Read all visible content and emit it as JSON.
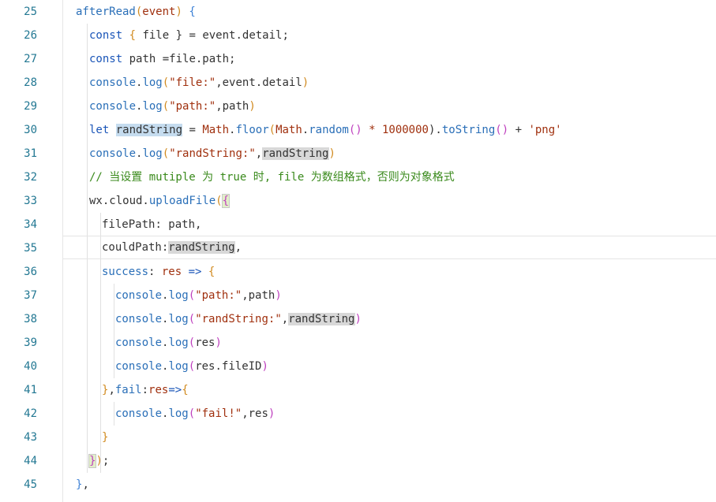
{
  "editor": {
    "line_numbers": [
      "25",
      "26",
      "27",
      "28",
      "29",
      "30",
      "31",
      "32",
      "33",
      "34",
      "35",
      "36",
      "37",
      "38",
      "39",
      "40",
      "41",
      "42",
      "43",
      "44",
      "45"
    ],
    "lines": {
      "l25": {
        "a": "afterRead",
        "b": "(",
        "c": "event",
        "d": ")",
        "e": " {"
      },
      "l26": {
        "a": "const",
        "b": " { ",
        "c": "file",
        "d": " } = event.detail;"
      },
      "l27": {
        "a": "const",
        "b": " path =file.path;"
      },
      "l28": {
        "a": "console",
        "b": ".",
        "c": "log",
        "d": "(",
        "e": "\"file:\"",
        "f": ",event.detail",
        "g": ")"
      },
      "l29": {
        "a": "console",
        "b": ".",
        "c": "log",
        "d": "(",
        "e": "\"path:\"",
        "f": ",path",
        "g": ")"
      },
      "l30": {
        "a": "let",
        "b": " ",
        "c": "randString",
        "d": " = ",
        "e": "Math",
        "f": ".",
        "g": "floor",
        "h": "(",
        "i": "Math",
        "j": ".",
        "k": "random",
        "l": "()",
        "m": " * ",
        "n": "1000000",
        "o": ").",
        "p": "toString",
        "q": "()",
        "r": " + ",
        "s": "'png'"
      },
      "l31": {
        "a": "console",
        "b": ".",
        "c": "log",
        "d": "(",
        "e": "\"randString:\"",
        "f": ",",
        "g": "randString",
        "h": ")"
      },
      "l32": {
        "a": "// 当设置 mutiple 为 true 时, file 为数组格式，否则为对象格式"
      },
      "l33": {
        "a": "wx.cloud.",
        "b": "uploadFile",
        "c": "(",
        "d": "{"
      },
      "l34": {
        "a": "filePath",
        "b": ": path,"
      },
      "l35": {
        "a": "couldPath",
        "b": ":",
        "c": "randString",
        "d": ","
      },
      "l36": {
        "a": "success",
        "b": ": ",
        "c": "res",
        "d": " => ",
        "e": "{"
      },
      "l37": {
        "a": "console",
        "b": ".",
        "c": "log",
        "d": "(",
        "e": "\"path:\"",
        "f": ",path",
        "g": ")"
      },
      "l38": {
        "a": "console",
        "b": ".",
        "c": "log",
        "d": "(",
        "e": "\"randString:\"",
        "f": ",",
        "g": "randString",
        "h": ")"
      },
      "l39": {
        "a": "console",
        "b": ".",
        "c": "log",
        "d": "(",
        "e": "res",
        "f": ")"
      },
      "l40": {
        "a": "console",
        "b": ".",
        "c": "log",
        "d": "(",
        "e": "res.fileID",
        "f": ")"
      },
      "l41": {
        "a": "}",
        "b": ",",
        "c": "fail",
        "d": ":",
        "e": "res",
        "f": "=>",
        "g": "{"
      },
      "l42": {
        "a": "console",
        "b": ".",
        "c": "log",
        "d": "(",
        "e": "\"fail!\"",
        "f": ",res",
        "g": ")"
      },
      "l43": {
        "a": "}"
      },
      "l44": {
        "a": "}",
        "b": ")",
        "c": ";"
      },
      "l45": {
        "a": "}",
        "b": ","
      }
    },
    "colors": {
      "line_number": "#237893",
      "keyword": "#1a55b8",
      "string": "#a0300e",
      "number": "#098658",
      "comment": "#3a8a1c",
      "selection": "#c5dcef",
      "occurrence": "#d8d8d8"
    }
  }
}
